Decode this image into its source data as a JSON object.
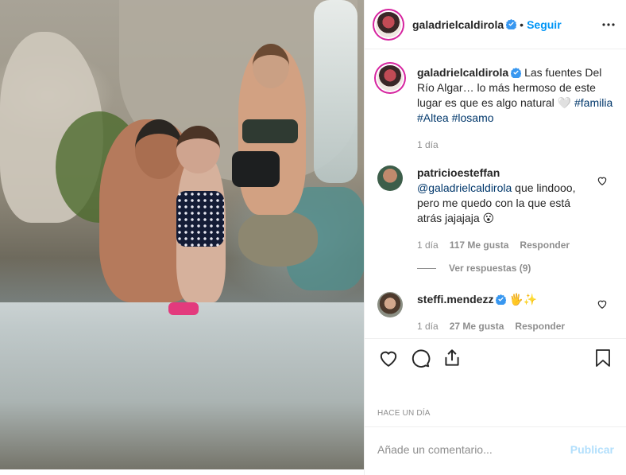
{
  "post": {
    "photo_alt": "",
    "author": "galadrielcaldirola",
    "follow_label": "Seguir",
    "separator": "•",
    "caption": {
      "text": "Las fuentes Del Río Algar… lo más hermoso de este lugar es que es algo natural 🤍",
      "hashtags": [
        "#familia",
        "#Altea",
        "#losamo"
      ],
      "time": "1 día"
    }
  },
  "comments": [
    {
      "user": "patricioesteffan",
      "mention": "@galadrielcaldirola",
      "text": " que lindooo, pero me quedo con la que está atrás jajajaja 😮",
      "time": "1 día",
      "likes": "117 Me gusta",
      "reply_label": "Responder",
      "view_replies": "Ver respuestas (9)"
    },
    {
      "user": "steffi.mendezz",
      "text": "🖐✨",
      "time": "1 día",
      "likes": "27 Me gusta",
      "reply_label": "Responder"
    }
  ],
  "footer": {
    "date": "Hace un día",
    "comment_placeholder": "Añade un comentario...",
    "publish_label": "Publicar"
  },
  "colors": {
    "accent": "#0095f6",
    "verified": "#3897f0",
    "muted": "#8e8e8e",
    "publish_disabled": "#b2dffc",
    "hashtag": "#00376b"
  },
  "icons": [
    "verified-badge-icon",
    "more-options-icon",
    "heart-icon",
    "comment-icon",
    "share-icon",
    "bookmark-icon"
  ]
}
